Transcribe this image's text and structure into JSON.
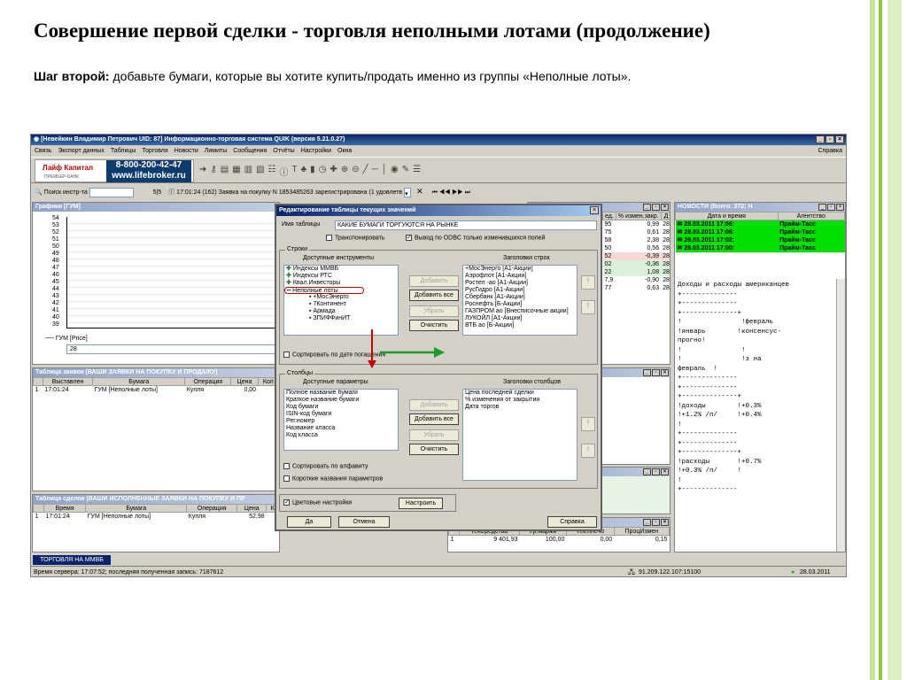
{
  "slide": {
    "title": "Совершение первой сделки - торговля неполными лотами (продолжение)",
    "step_label": "Шаг второй:",
    "step_text": " добавьте бумаги, которые вы хотите купить/продать именно из группы «Неполные лоты».",
    "accent_green": "#8dc63f"
  },
  "app": {
    "title": "[Невейкин Владимир Петрович UID: 87] Информационно-торговая система QUIK (версия 5.21.0.27)",
    "menu": [
      "Связь",
      "Экспорт данных",
      "Таблицы",
      "Торговля",
      "Новости",
      "Лимиты",
      "Сообщения",
      "Отчёты",
      "Настройки",
      "Окна"
    ],
    "help": "Справка",
    "banner_logo": "Лайф Капитал",
    "banner_logo_small": "ПРЕМЬЕР-БАНК",
    "banner_phone": "8-800-200-42-47",
    "banner_site": "www.lifebroker.ru",
    "search_label": "Поиск инстр-та",
    "page_counter": "5|5",
    "message": "17:01:24  (162) Заявка на покупку N 1853485263 зарегистрирована (1 удовлетв",
    "close_x": "✕"
  },
  "chart_panel": {
    "title": "Графики [ГУМ]",
    "y_labels": [
      "54",
      "53",
      "52",
      "51",
      "50",
      "49",
      "48",
      "47",
      "46",
      "45",
      "44",
      "43",
      "42",
      "41",
      "40",
      "39"
    ],
    "legend": "ГУМ [Price]",
    "value_box": "28"
  },
  "orders_panel": {
    "title": "Таблица заявок (ВАШИ ЗАЯВКИ НА ПОКУПКУ И ПРОДАЖУ)",
    "headers": [
      "Выставлен",
      "Бумага",
      "Операция",
      "Цена",
      "Кол"
    ],
    "row": {
      "n": "1",
      "time": "17:01:24",
      "paper": "ГУМ [Неполные лоты]",
      "op": "Купля",
      "price": "0,00"
    }
  },
  "deals_panel": {
    "title": "Таблица сделок (ВАШИ ИСПОЛНЕННЫЕ ЗАЯВКИ НА ПОКУПКУ И ПР",
    "headers": [
      "Время",
      "Бумага",
      "Операция",
      "Цена",
      "К"
    ],
    "row": {
      "n": "1",
      "time": "17:01:24",
      "paper": "ГУМ [Неполные лоты]",
      "op": "Купля",
      "price": "52,98"
    }
  },
  "quotes_panel": {
    "headers": [
      "ед.",
      "% измен.закр.",
      "Д"
    ],
    "rows": [
      [
        "95",
        "0,99",
        "28"
      ],
      [
        "75",
        "0,61",
        "28"
      ],
      [
        "58",
        "2,38",
        "28"
      ],
      [
        "50",
        "0,56",
        "28"
      ],
      [
        "52",
        "-0,39",
        "28"
      ],
      [
        "02",
        "-0,36",
        "28"
      ],
      [
        "22",
        "1,08",
        "28"
      ],
      [
        "7,9",
        "-0,90",
        "28"
      ],
      [
        "77",
        "0,63",
        "28"
      ]
    ]
  },
  "limits_panel": {
    "headers": [
      "ТекСредства",
      "Ур.маржи",
      "Тек.плечо",
      "ПроцИзмен"
    ],
    "row": {
      "n": "1",
      "cash": "9 401,93",
      "margin": "100,00",
      "leverage": "0,00",
      "change": "0,15"
    }
  },
  "news_panel": {
    "title": "НОВОСТИ (Всего: 372; Н",
    "headers": [
      "Дата и время",
      "Агентство"
    ],
    "items": [
      {
        "dt": "28.03.2011 17:06:",
        "agency": "Прайм-Тасс"
      },
      {
        "dt": "28.03.2011 17:06:",
        "agency": "Прайм-Тасс"
      },
      {
        "dt": "28.03.2011 17:02:",
        "agency": "Прайм-Тасс"
      },
      {
        "dt": "28.03.2011 17:00:",
        "agency": "Прайм-Тасс"
      }
    ],
    "body": [
      "Доходы и расходы американцев",
      "+--------------",
      "+--------------",
      "+--------------+",
      "!               !февраль",
      "!январь        !консенсус-",
      "прогно!",
      "!               !",
      "!               !з на",
      "февраль  !",
      "+--------------",
      "+--------------",
      "+--------------+",
      "!доходы        !+0.3%",
      "!+1.2% /п/     !+0.4%",
      "!",
      "+--------------",
      "+--------------",
      "+--------------+",
      "!расходы       !+0.7%",
      "!+0.3% /п/     !",
      "!",
      "+--------------"
    ]
  },
  "dialog": {
    "title": "Редактирование таблицы текущих значений",
    "table_name_label": "Имя таблицы",
    "table_name_value": "КАКИЕ БУМАГИ ТОРГУЮТСЯ НА РЫНКЕ",
    "transpose_label": "Транспонировать",
    "odbc_label": "Вывод по ODBC только изменившихся  полей",
    "rows_legend": "Строки",
    "available_instruments": "Доступные инструменты",
    "row_headers": "Заголовки строк",
    "instruments": [
      "Индексы ММВБ",
      "Индексы РТС",
      "Квал.Инвесторы",
      "Неполные лоты",
      "+МосЭнерго",
      "7Континент",
      "Армада",
      "ЗПИФФинИТ"
    ],
    "row_list": [
      "+МосЭнерго [А1-Акции]",
      "Аэрофлот [А1-Акции]",
      "Ростел -ао [А1-Акции]",
      "РусГидро [А1-Акции]",
      "Сбербанк [А1-Акции]",
      "Роснефть [Б-Акции]",
      "ГАЗПРОМ ао [Внесписочные акции]",
      "ЛУКОЙЛ [А1-Акции]",
      "ВТБ ао [Б-Акции]"
    ],
    "btn_add": "Добавить",
    "btn_add_all": "Добавить все",
    "btn_remove": "Убрать",
    "btn_clear": "Очистить",
    "sort_expiry": "Сортировать по дате погашения",
    "cols_legend": "Столбцы",
    "available_params": "Доступные параметры",
    "col_headers": "Заголовки столбцов",
    "params": [
      "Полное название бумаги",
      "Краткое название бумаги",
      "Код бумаги",
      "ISIN-код бумаги",
      "Рег.номер",
      "Название класса",
      "Код класса"
    ],
    "col_list": [
      "Цена последней сделки",
      "% изменения от закрытия",
      "Дата торгов"
    ],
    "sort_alpha": "Сортировать по алфавиту",
    "short_names": "Короткие названия параметров",
    "color_settings": "Цветовые настройки",
    "btn_setup": "Настроить",
    "btn_ok": "Да",
    "btn_cancel": "Отмена",
    "btn_help": "Справка"
  },
  "status": {
    "task_button": "ТОРГОВЛЯ НА ММВБ",
    "server_time": "Время сервера: 17:07:52; последняя полученная запись: 7187612",
    "ip": "91.209.122.107:15100",
    "date": "28.03.2011"
  }
}
